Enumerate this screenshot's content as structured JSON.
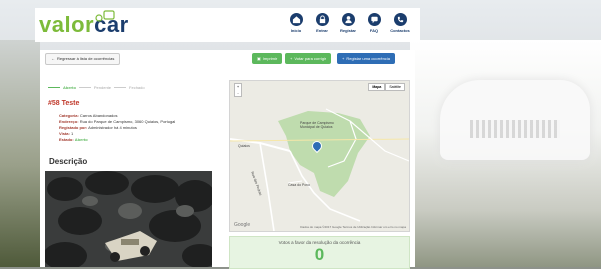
{
  "brand": {
    "part1": "valor",
    "part2": "car"
  },
  "nav": [
    {
      "label": "Início",
      "icon": "home-icon"
    },
    {
      "label": "Entrar",
      "icon": "lock-icon"
    },
    {
      "label": "Registar",
      "icon": "user-icon"
    },
    {
      "label": "FAQ",
      "icon": "chat-icon"
    },
    {
      "label": "Contactos",
      "icon": "phone-icon"
    }
  ],
  "toolbar": {
    "back": "Regressar à lista de ocorrências",
    "print": "Imprimir",
    "vote": "Votar para corrigir",
    "report": "Registar uma ocorrência"
  },
  "steps": [
    "Aberto",
    "Pendente",
    "Fechado"
  ],
  "occurrence": {
    "title": "#58 Teste",
    "category_label": "Categoria:",
    "category": "Carros Abandonados",
    "address_label": "Endereço:",
    "address": "Rua do Parque de Campismo, 3060 Quiaios, Portugal",
    "registered_label": "Registado por:",
    "registered": "Administrador há 4 minutos",
    "views_label": "Vista:",
    "views": "1",
    "state_label": "Estado:",
    "state": "Aberto"
  },
  "description_heading": "Descrição",
  "map": {
    "type_map": "Mapa",
    "type_sat": "Satélite",
    "zoom_in": "+",
    "zoom_out": "-",
    "labels": {
      "park": "Parque de Campismo Municipal de Quiaios",
      "street1": "Quiaios",
      "street2": "Rua das Pedras",
      "place": "Casa do Povo"
    },
    "google": "Google",
    "footer": "Dados do mapa ©2017 Google   Termos de Utilização   Informar um erro no mapa"
  },
  "vote_box": {
    "text": "Votos a favor da resolução da ocorrência",
    "count": "0"
  },
  "colors": {
    "green": "#5cb85c",
    "navy": "#1b3d6d",
    "brand_green": "#7dbb3a",
    "blue": "#2e6db5"
  }
}
